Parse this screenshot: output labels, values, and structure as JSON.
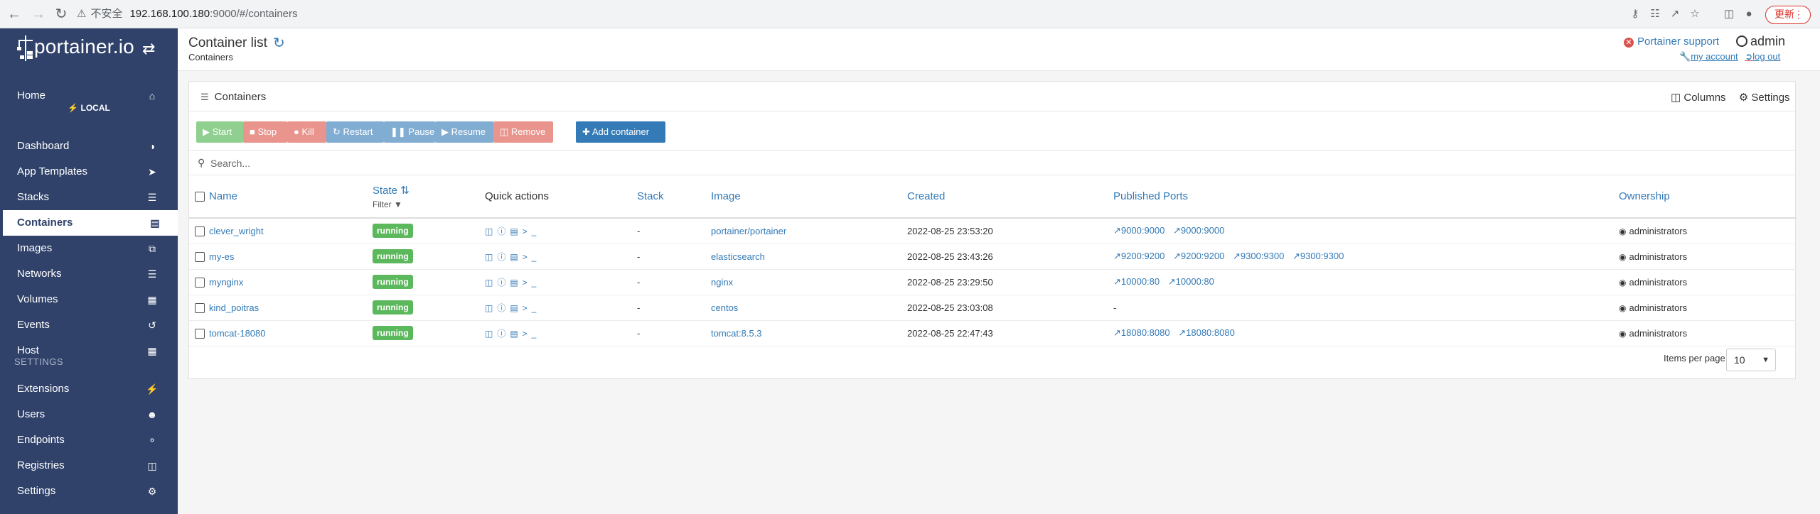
{
  "browser": {
    "insecure_label": "不安全",
    "url_host": "192.168.100.180",
    "url_rest": ":9000/#/containers",
    "update_label": "更新"
  },
  "sidebar": {
    "logo_text": "portainer.io",
    "endpoint_label": "LOCAL",
    "settings_header": "SETTINGS",
    "items": [
      {
        "label": "Home",
        "icon": "home-icon"
      },
      {
        "label": "Dashboard",
        "icon": "tachometer-icon"
      },
      {
        "label": "App Templates",
        "icon": "rocket-icon"
      },
      {
        "label": "Stacks",
        "icon": "list-icon"
      },
      {
        "label": "Containers",
        "icon": "server-icon"
      },
      {
        "label": "Images",
        "icon": "clone-icon"
      },
      {
        "label": "Networks",
        "icon": "sitemap-icon"
      },
      {
        "label": "Volumes",
        "icon": "cubes-icon"
      },
      {
        "label": "Events",
        "icon": "history-icon"
      },
      {
        "label": "Host",
        "icon": "th-icon"
      }
    ],
    "settings_items": [
      {
        "label": "Extensions",
        "icon": "bolt-icon"
      },
      {
        "label": "Users",
        "icon": "users-icon"
      },
      {
        "label": "Endpoints",
        "icon": "plug-icon"
      },
      {
        "label": "Registries",
        "icon": "database-icon"
      },
      {
        "label": "Settings",
        "icon": "cogs-icon"
      }
    ]
  },
  "header": {
    "title": "Container list",
    "breadcrumb": "Containers",
    "support": "Portainer support",
    "user": "admin",
    "my_account": "my account",
    "log_out": "log out"
  },
  "panel": {
    "title": "Containers",
    "columns_label": "Columns",
    "settings_label": "Settings",
    "buttons": {
      "start": "Start",
      "stop": "Stop",
      "kill": "Kill",
      "restart": "Restart",
      "pause": "Pause",
      "resume": "Resume",
      "remove": "Remove",
      "add": "Add container"
    },
    "search_placeholder": "Search...",
    "columns": {
      "name": "Name",
      "state": "State",
      "filter": "Filter",
      "quick_actions": "Quick actions",
      "stack": "Stack",
      "image": "Image",
      "created": "Created",
      "ports": "Published Ports",
      "ownership": "Ownership"
    },
    "rows": [
      {
        "name": "clever_wright",
        "state": "running",
        "stack": "-",
        "image": "portainer/portainer",
        "created": "2022-08-25 23:53:20",
        "ports": [
          "9000:9000",
          "9000:9000"
        ],
        "ownership": "administrators"
      },
      {
        "name": "my-es",
        "state": "running",
        "stack": "-",
        "image": "elasticsearch",
        "created": "2022-08-25 23:43:26",
        "ports": [
          "9200:9200",
          "9200:9200",
          "9300:9300",
          "9300:9300"
        ],
        "ownership": "administrators"
      },
      {
        "name": "mynginx",
        "state": "running",
        "stack": "-",
        "image": "nginx",
        "created": "2022-08-25 23:29:50",
        "ports": [
          "10000:80",
          "10000:80"
        ],
        "ownership": "administrators"
      },
      {
        "name": "kind_poitras",
        "state": "running",
        "stack": "-",
        "image": "centos",
        "created": "2022-08-25 23:03:08",
        "ports": [],
        "ports_empty": "-",
        "ownership": "administrators"
      },
      {
        "name": "tomcat-18080",
        "state": "running",
        "stack": "-",
        "image": "tomcat:8.5.3",
        "created": "2022-08-25 22:47:43",
        "ports": [
          "18080:8080",
          "18080:8080"
        ],
        "ownership": "administrators"
      }
    ],
    "items_per_page_label": "Items per page",
    "items_per_page_value": "10"
  }
}
